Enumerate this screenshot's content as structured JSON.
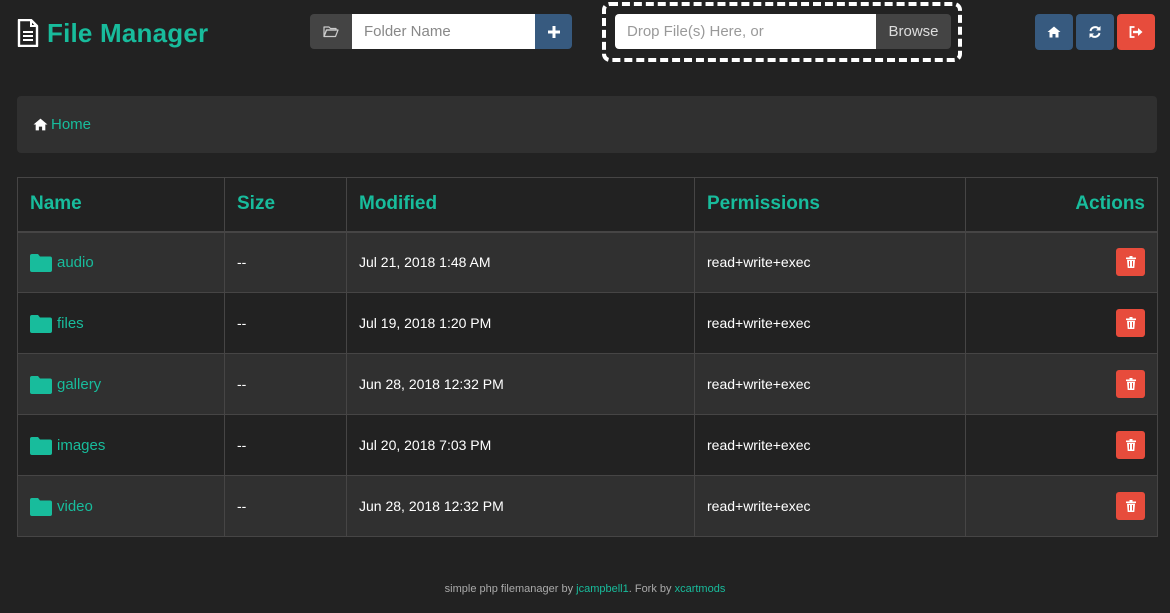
{
  "brand": {
    "title": "File Manager",
    "icon": "file-text-icon"
  },
  "folder_form": {
    "placeholder": "Folder Name",
    "addon_icon": "folder-open-icon",
    "add_icon": "plus-icon"
  },
  "upload": {
    "placeholder": "Drop File(s) Here, or",
    "browse_label": "Browse"
  },
  "top_buttons": [
    {
      "icon": "home-icon",
      "color": "#375a7f"
    },
    {
      "icon": "refresh-icon",
      "color": "#375a7f"
    },
    {
      "icon": "sign-out-icon",
      "color": "#e74c3c"
    }
  ],
  "breadcrumb": {
    "home_label": "Home",
    "icon": "home-icon"
  },
  "table": {
    "headers": {
      "name": "Name",
      "size": "Size",
      "modified": "Modified",
      "permissions": "Permissions",
      "actions": "Actions"
    },
    "rows": [
      {
        "name": "audio",
        "size": "--",
        "modified": "Jul 21, 2018 1:48 AM",
        "permissions": "read+write+exec"
      },
      {
        "name": "files",
        "size": "--",
        "modified": "Jul 19, 2018 1:20 PM",
        "permissions": "read+write+exec"
      },
      {
        "name": "gallery",
        "size": "--",
        "modified": "Jun 28, 2018 12:32 PM",
        "permissions": "read+write+exec"
      },
      {
        "name": "images",
        "size": "--",
        "modified": "Jul 20, 2018 7:03 PM",
        "permissions": "read+write+exec"
      },
      {
        "name": "video",
        "size": "--",
        "modified": "Jun 28, 2018 12:32 PM",
        "permissions": "read+write+exec"
      }
    ]
  },
  "footer": {
    "text1": "simple php filemanager by ",
    "link1": "jcampbell1",
    "text2": ". Fork by ",
    "link2": "xcartmods"
  },
  "colors": {
    "accent": "#18bc9c",
    "primary": "#375a7f",
    "danger": "#e74c3c",
    "background": "#222222"
  }
}
